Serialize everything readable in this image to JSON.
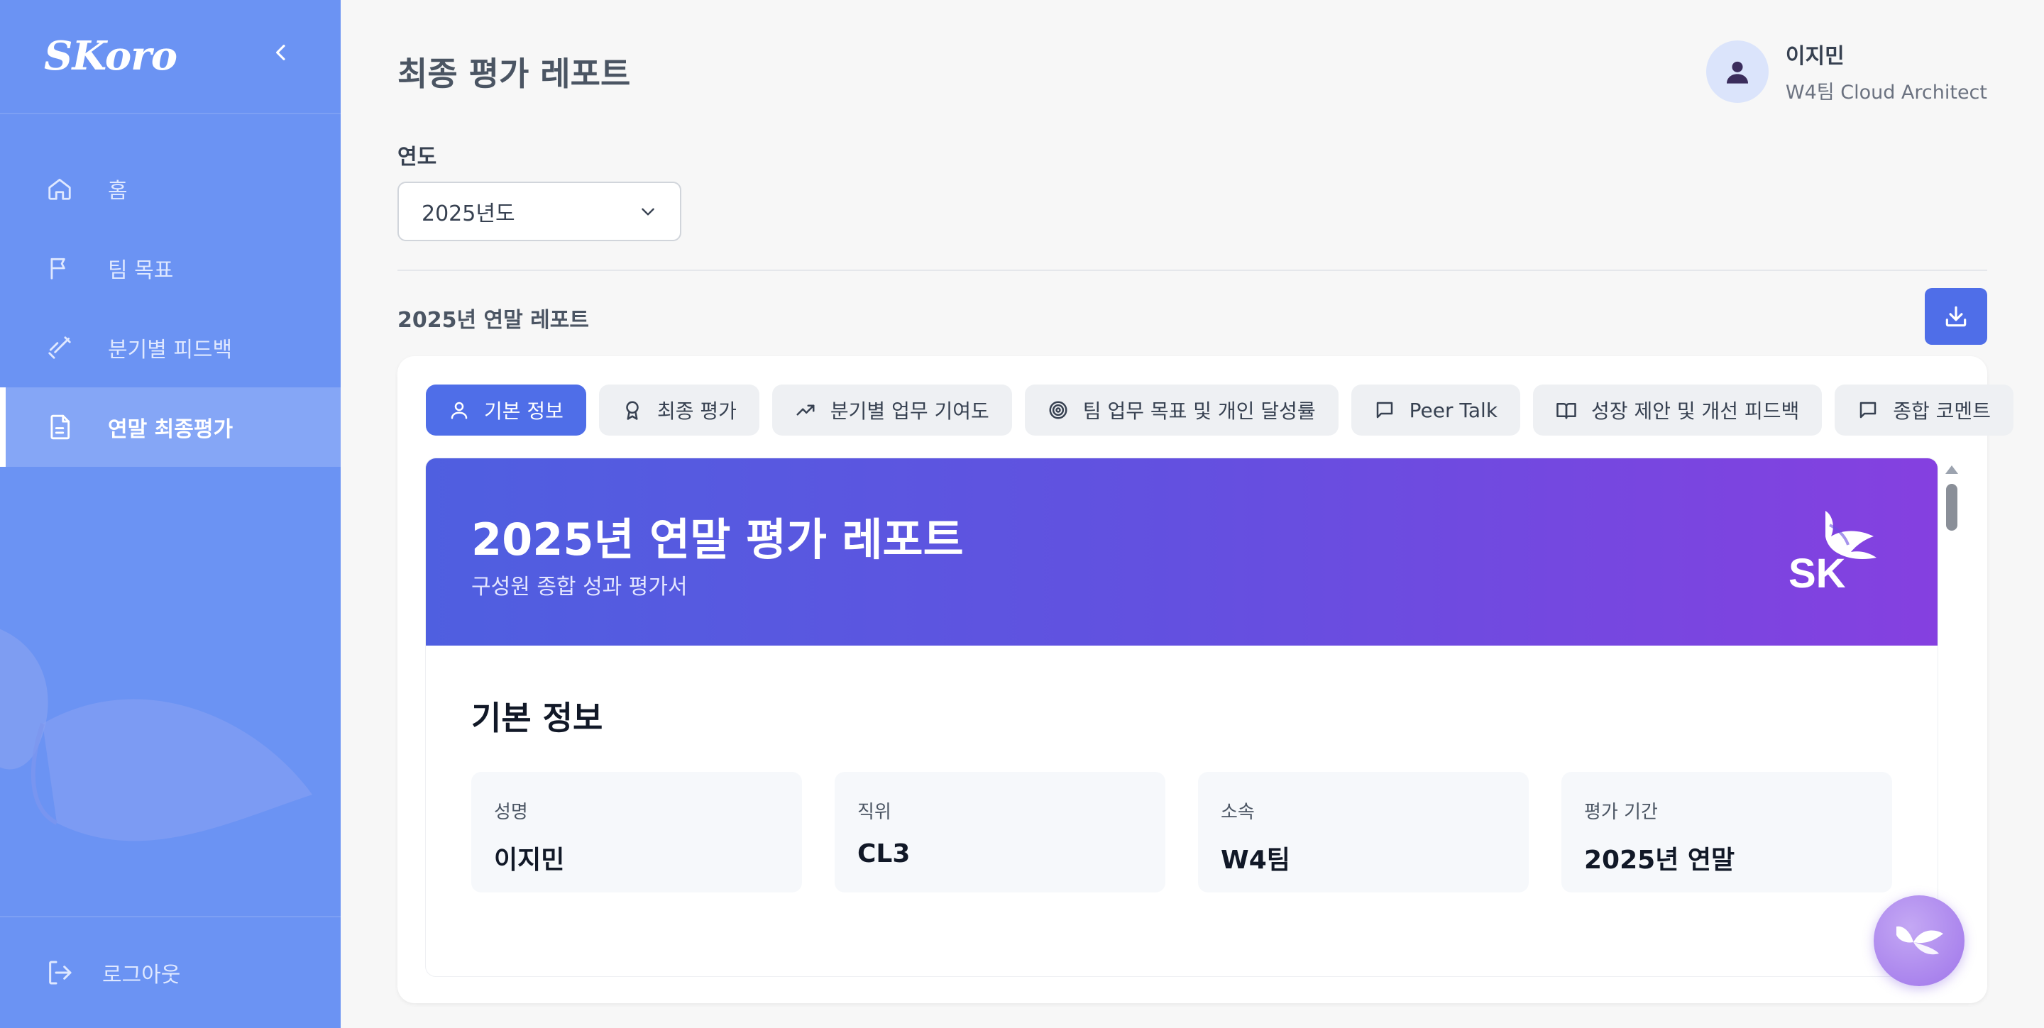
{
  "sidebar": {
    "logo": "SKoro",
    "items": [
      {
        "label": "홈",
        "icon": "home-icon"
      },
      {
        "label": "팀 목표",
        "icon": "flag-icon"
      },
      {
        "label": "분기별 피드백",
        "icon": "dumbbell-icon"
      },
      {
        "label": "연말 최종평가",
        "icon": "document-icon",
        "active": true
      }
    ],
    "logout_label": "로그아웃"
  },
  "header": {
    "title": "최종 평가 레포트",
    "user_name": "이지민",
    "user_role": "W4팀 Cloud Architect"
  },
  "filters": {
    "year_label": "연도",
    "year_value": "2025년도"
  },
  "report": {
    "label": "2025년 연말 레포트",
    "tabs": [
      {
        "label": "기본 정보",
        "icon": "user-icon",
        "active": true
      },
      {
        "label": "최종 평가",
        "icon": "award-icon"
      },
      {
        "label": "분기별 업무 기여도",
        "icon": "trending-up-icon"
      },
      {
        "label": "팀 업무 목표 및 개인 달성률",
        "icon": "target-icon"
      },
      {
        "label": "Peer Talk",
        "icon": "message-icon"
      },
      {
        "label": "성장 제안 및 개선 피드백",
        "icon": "book-open-icon"
      },
      {
        "label": "종합 코멘트",
        "icon": "message-icon"
      }
    ],
    "banner_title": "2025년 연말 평가 레포트",
    "banner_subtitle": "구성원 종합 성과 평가서",
    "brand": "SK",
    "section_title": "기본 정보",
    "info": [
      {
        "label": "성명",
        "value": "이지민"
      },
      {
        "label": "직위",
        "value": "CL3"
      },
      {
        "label": "소속",
        "value": "W4팀"
      },
      {
        "label": "평가 기간",
        "value": "2025년 연말"
      }
    ]
  },
  "colors": {
    "sidebar": "#6b93f3",
    "accent": "#4f6ee8",
    "banner_start": "#4f5fe0",
    "banner_end": "#8540e0"
  }
}
